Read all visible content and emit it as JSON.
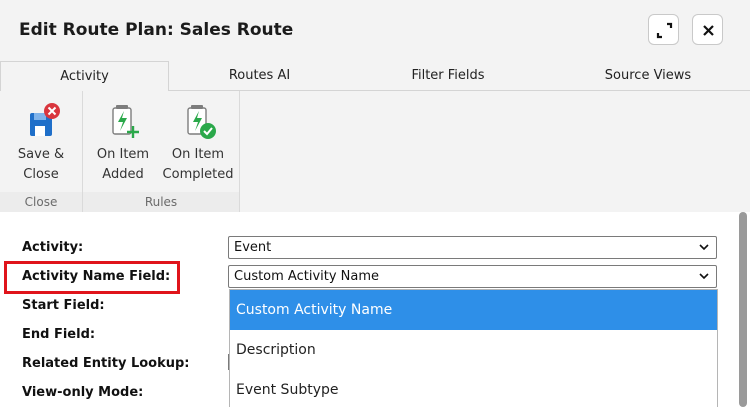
{
  "dialog": {
    "title": "Edit Route Plan: Sales Route"
  },
  "titlebar_buttons": {
    "maximize_icon": "expand-icon",
    "close_icon": "close-icon"
  },
  "tabs": [
    {
      "label": "Activity",
      "active": true
    },
    {
      "label": "Routes AI",
      "active": false
    },
    {
      "label": "Filter Fields",
      "active": false
    },
    {
      "label": "Source Views",
      "active": false
    }
  ],
  "ribbon": {
    "groups": [
      {
        "label": "Close",
        "buttons": [
          {
            "label_line1": "Save &",
            "label_line2": "Close",
            "icon": "save-close-icon"
          }
        ]
      },
      {
        "label": "Rules",
        "buttons": [
          {
            "label_line1": "On Item",
            "label_line2": "Added",
            "icon": "rule-added-icon"
          },
          {
            "label_line1": "On Item",
            "label_line2": "Completed",
            "icon": "rule-completed-icon"
          }
        ]
      }
    ]
  },
  "form": {
    "fields": [
      {
        "label": "Activity:",
        "value": "Event"
      },
      {
        "label": "Activity Name Field:",
        "value": "Custom Activity Name"
      },
      {
        "label": "Start Field:"
      },
      {
        "label": "End Field:"
      },
      {
        "label": "Related Entity Lookup:"
      },
      {
        "label": "View-only Mode:"
      }
    ]
  },
  "dropdown": {
    "options": [
      "Custom Activity Name",
      "Description",
      "Event Subtype"
    ],
    "selected": "Custom Activity Name"
  },
  "colors": {
    "highlight_border": "#e0141b",
    "selected_option": "#2e8fe8",
    "icon_green": "#2aa84a",
    "icon_blue": "#1f6fc9",
    "icon_red": "#d9363e"
  }
}
